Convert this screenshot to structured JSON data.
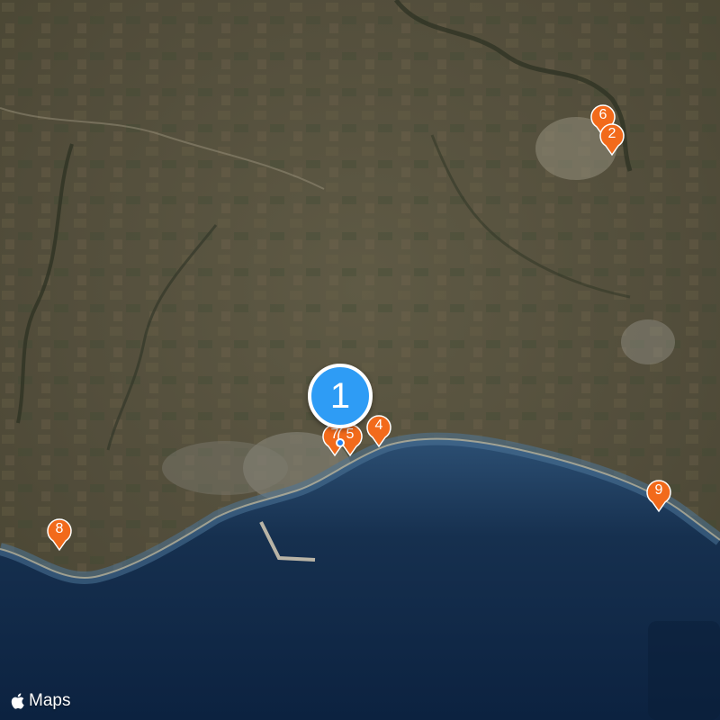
{
  "map": {
    "type": "satellite",
    "attribution": "Maps",
    "cluster_marker": {
      "label": "1",
      "color": "#2e9cf5"
    },
    "markers": [
      {
        "label": "6",
        "color": "#f26a1b"
      },
      {
        "label": "2",
        "color": "#f26a1b"
      },
      {
        "label": "7",
        "color": "#f26a1b"
      },
      {
        "label": "5",
        "color": "#f26a1b"
      },
      {
        "label": "4",
        "color": "#f26a1b"
      },
      {
        "label": "9",
        "color": "#f26a1b"
      },
      {
        "label": "8",
        "color": "#f26a1b"
      }
    ]
  }
}
